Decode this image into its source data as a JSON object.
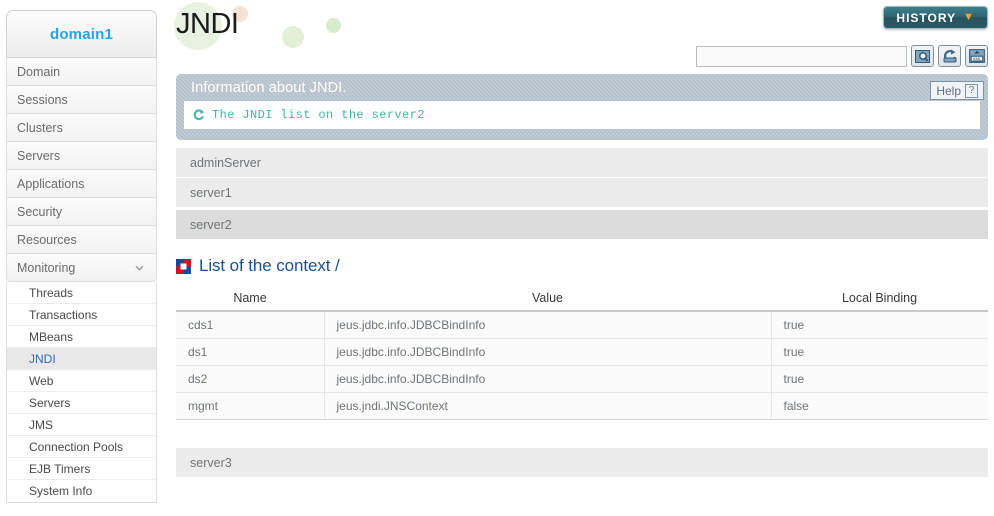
{
  "sidebar": {
    "domain_label": "domain1",
    "top_items": [
      {
        "label": "Domain"
      },
      {
        "label": "Sessions"
      },
      {
        "label": "Clusters"
      },
      {
        "label": "Servers"
      },
      {
        "label": "Applications"
      },
      {
        "label": "Security"
      },
      {
        "label": "Resources"
      },
      {
        "label": "Monitoring",
        "expanded": true,
        "icon": "chevron-down-icon"
      }
    ],
    "sub_items": [
      {
        "label": "Threads"
      },
      {
        "label": "Transactions"
      },
      {
        "label": "MBeans"
      },
      {
        "label": "JNDI",
        "active": true
      },
      {
        "label": "Web"
      },
      {
        "label": "Servers"
      },
      {
        "label": "JMS"
      },
      {
        "label": "Connection Pools"
      },
      {
        "label": "EJB Timers"
      },
      {
        "label": "System Info"
      }
    ]
  },
  "header": {
    "page_title": "JNDI",
    "history_label": "HISTORY",
    "history_icon": "chevron-down-icon",
    "help_label": "Help",
    "help_icon": "question-mark-icon"
  },
  "search": {
    "value": "",
    "placeholder": "",
    "buttons": [
      {
        "icon": "search-icon",
        "name": "search-button"
      },
      {
        "icon": "refresh-icon",
        "name": "refresh-button"
      },
      {
        "icon": "xml-export-icon",
        "name": "xml-export-button"
      }
    ]
  },
  "info": {
    "title": "Information about JNDI.",
    "message": "The JNDI list on the server2",
    "icon": "refresh-icon",
    "accent_color": "#41b3a8"
  },
  "servers": [
    {
      "name": "adminServer",
      "selected": false
    },
    {
      "name": "server1",
      "selected": false
    },
    {
      "name": "server2",
      "selected": true
    },
    {
      "name": "server3",
      "selected": false
    }
  ],
  "context": {
    "heading": "List of the context /",
    "icon": "app-logo-icon",
    "heading_color": "#1c4f93"
  },
  "table": {
    "columns": [
      "Name",
      "Value",
      "Local Binding"
    ],
    "rows": [
      {
        "name": "cds1",
        "value": "jeus.jdbc.info.JDBCBindInfo",
        "local_binding": "true"
      },
      {
        "name": "ds1",
        "value": "jeus.jdbc.info.JDBCBindInfo",
        "local_binding": "true"
      },
      {
        "name": "ds2",
        "value": "jeus.jdbc.info.JDBCBindInfo",
        "local_binding": "true"
      },
      {
        "name": "mgmt",
        "value": "jeus.jndi.JNSContext",
        "local_binding": "false"
      }
    ]
  }
}
